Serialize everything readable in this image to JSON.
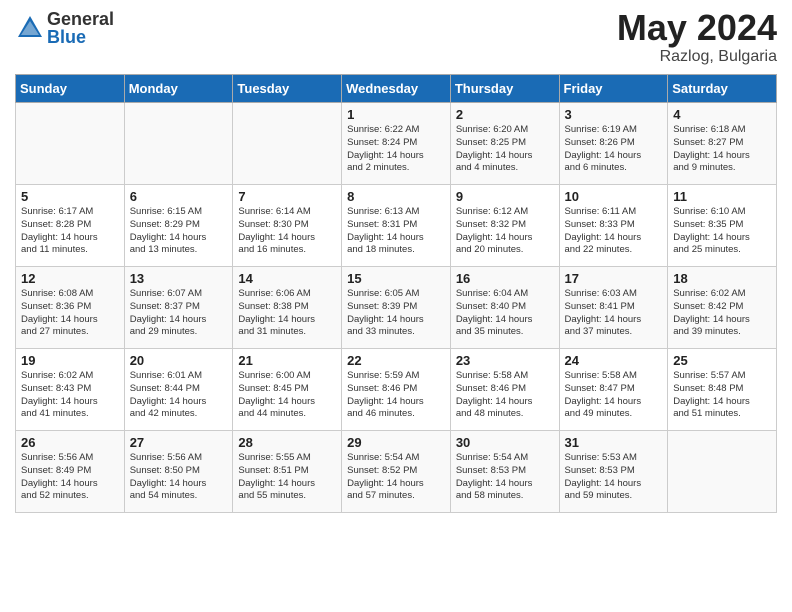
{
  "logo": {
    "general": "General",
    "blue": "Blue"
  },
  "title": {
    "month_year": "May 2024",
    "location": "Razlog, Bulgaria"
  },
  "headers": [
    "Sunday",
    "Monday",
    "Tuesday",
    "Wednesday",
    "Thursday",
    "Friday",
    "Saturday"
  ],
  "weeks": [
    [
      {
        "day": "",
        "info": ""
      },
      {
        "day": "",
        "info": ""
      },
      {
        "day": "",
        "info": ""
      },
      {
        "day": "1",
        "info": "Sunrise: 6:22 AM\nSunset: 8:24 PM\nDaylight: 14 hours\nand 2 minutes."
      },
      {
        "day": "2",
        "info": "Sunrise: 6:20 AM\nSunset: 8:25 PM\nDaylight: 14 hours\nand 4 minutes."
      },
      {
        "day": "3",
        "info": "Sunrise: 6:19 AM\nSunset: 8:26 PM\nDaylight: 14 hours\nand 6 minutes."
      },
      {
        "day": "4",
        "info": "Sunrise: 6:18 AM\nSunset: 8:27 PM\nDaylight: 14 hours\nand 9 minutes."
      }
    ],
    [
      {
        "day": "5",
        "info": "Sunrise: 6:17 AM\nSunset: 8:28 PM\nDaylight: 14 hours\nand 11 minutes."
      },
      {
        "day": "6",
        "info": "Sunrise: 6:15 AM\nSunset: 8:29 PM\nDaylight: 14 hours\nand 13 minutes."
      },
      {
        "day": "7",
        "info": "Sunrise: 6:14 AM\nSunset: 8:30 PM\nDaylight: 14 hours\nand 16 minutes."
      },
      {
        "day": "8",
        "info": "Sunrise: 6:13 AM\nSunset: 8:31 PM\nDaylight: 14 hours\nand 18 minutes."
      },
      {
        "day": "9",
        "info": "Sunrise: 6:12 AM\nSunset: 8:32 PM\nDaylight: 14 hours\nand 20 minutes."
      },
      {
        "day": "10",
        "info": "Sunrise: 6:11 AM\nSunset: 8:33 PM\nDaylight: 14 hours\nand 22 minutes."
      },
      {
        "day": "11",
        "info": "Sunrise: 6:10 AM\nSunset: 8:35 PM\nDaylight: 14 hours\nand 25 minutes."
      }
    ],
    [
      {
        "day": "12",
        "info": "Sunrise: 6:08 AM\nSunset: 8:36 PM\nDaylight: 14 hours\nand 27 minutes."
      },
      {
        "day": "13",
        "info": "Sunrise: 6:07 AM\nSunset: 8:37 PM\nDaylight: 14 hours\nand 29 minutes."
      },
      {
        "day": "14",
        "info": "Sunrise: 6:06 AM\nSunset: 8:38 PM\nDaylight: 14 hours\nand 31 minutes."
      },
      {
        "day": "15",
        "info": "Sunrise: 6:05 AM\nSunset: 8:39 PM\nDaylight: 14 hours\nand 33 minutes."
      },
      {
        "day": "16",
        "info": "Sunrise: 6:04 AM\nSunset: 8:40 PM\nDaylight: 14 hours\nand 35 minutes."
      },
      {
        "day": "17",
        "info": "Sunrise: 6:03 AM\nSunset: 8:41 PM\nDaylight: 14 hours\nand 37 minutes."
      },
      {
        "day": "18",
        "info": "Sunrise: 6:02 AM\nSunset: 8:42 PM\nDaylight: 14 hours\nand 39 minutes."
      }
    ],
    [
      {
        "day": "19",
        "info": "Sunrise: 6:02 AM\nSunset: 8:43 PM\nDaylight: 14 hours\nand 41 minutes."
      },
      {
        "day": "20",
        "info": "Sunrise: 6:01 AM\nSunset: 8:44 PM\nDaylight: 14 hours\nand 42 minutes."
      },
      {
        "day": "21",
        "info": "Sunrise: 6:00 AM\nSunset: 8:45 PM\nDaylight: 14 hours\nand 44 minutes."
      },
      {
        "day": "22",
        "info": "Sunrise: 5:59 AM\nSunset: 8:46 PM\nDaylight: 14 hours\nand 46 minutes."
      },
      {
        "day": "23",
        "info": "Sunrise: 5:58 AM\nSunset: 8:46 PM\nDaylight: 14 hours\nand 48 minutes."
      },
      {
        "day": "24",
        "info": "Sunrise: 5:58 AM\nSunset: 8:47 PM\nDaylight: 14 hours\nand 49 minutes."
      },
      {
        "day": "25",
        "info": "Sunrise: 5:57 AM\nSunset: 8:48 PM\nDaylight: 14 hours\nand 51 minutes."
      }
    ],
    [
      {
        "day": "26",
        "info": "Sunrise: 5:56 AM\nSunset: 8:49 PM\nDaylight: 14 hours\nand 52 minutes."
      },
      {
        "day": "27",
        "info": "Sunrise: 5:56 AM\nSunset: 8:50 PM\nDaylight: 14 hours\nand 54 minutes."
      },
      {
        "day": "28",
        "info": "Sunrise: 5:55 AM\nSunset: 8:51 PM\nDaylight: 14 hours\nand 55 minutes."
      },
      {
        "day": "29",
        "info": "Sunrise: 5:54 AM\nSunset: 8:52 PM\nDaylight: 14 hours\nand 57 minutes."
      },
      {
        "day": "30",
        "info": "Sunrise: 5:54 AM\nSunset: 8:53 PM\nDaylight: 14 hours\nand 58 minutes."
      },
      {
        "day": "31",
        "info": "Sunrise: 5:53 AM\nSunset: 8:53 PM\nDaylight: 14 hours\nand 59 minutes."
      },
      {
        "day": "",
        "info": ""
      }
    ]
  ]
}
